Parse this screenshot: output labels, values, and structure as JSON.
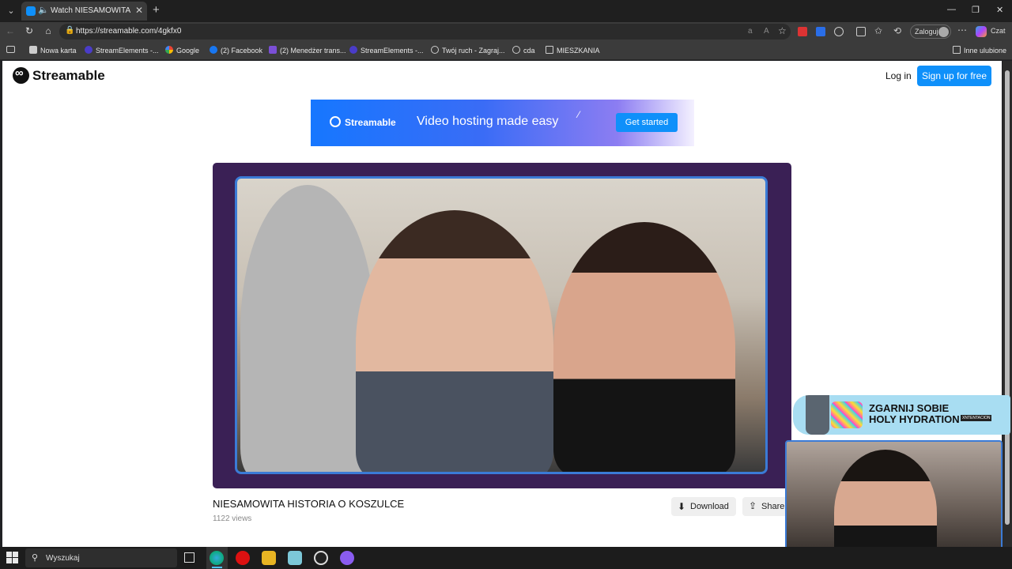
{
  "browser": {
    "tab": {
      "title": "Watch NIESAMOWITA HISTORIA O KOSZULCE",
      "audio_icon": "speaker-icon",
      "close": "✕"
    },
    "new_tab": "+",
    "window_controls": {
      "minimize": "—",
      "restore": "❐",
      "close": "✕"
    },
    "url": "https://streamable.com/4gkfx0",
    "login_pill": "Zaloguj",
    "copilot_label": "Czat",
    "bookmarks": [
      {
        "label": "Nowa karta"
      },
      {
        "label": "StreamElements -..."
      },
      {
        "label": "Google"
      },
      {
        "label": "(2) Facebook"
      },
      {
        "label": "(2) Menedżer trans..."
      },
      {
        "label": "StreamElements -..."
      },
      {
        "label": "Twój ruch - Zagraj..."
      },
      {
        "label": "cda"
      },
      {
        "label": "MIESZKANIA"
      }
    ],
    "other_favorites": "Inne ulubione"
  },
  "page": {
    "logo": "Streamable",
    "login": "Log in",
    "signup": "Sign up for free",
    "banner": {
      "brand": "Streamable",
      "headline": "Video hosting made easy",
      "cta": "Get started"
    },
    "video": {
      "title": "NIESAMOWITA HISTORIA O KOSZULCE",
      "views": "1122 views",
      "download": "Download",
      "share": "Share"
    }
  },
  "overlay": {
    "ad_text": "ZGARNIJ SOBIE\nHOLY HYDRATION",
    "ad_badge": "XNTENTACION"
  },
  "taskbar": {
    "search": "Wyszukaj"
  },
  "colors": {
    "brand_blue": "#0f90fa",
    "frame_blue": "#3b7bd6"
  }
}
